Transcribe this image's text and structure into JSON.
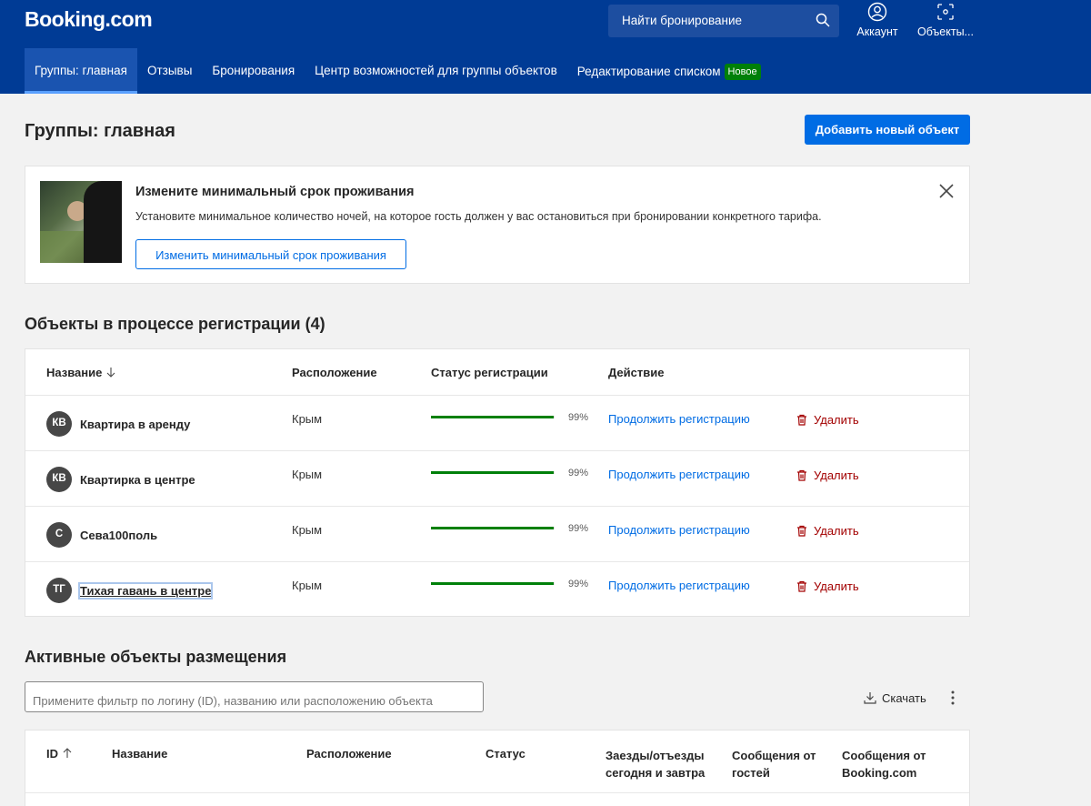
{
  "header": {
    "logo": "Booking.com",
    "search_label": "Найти бронирование",
    "account_label": "Аккаунт",
    "properties_label": "Объекты...",
    "nav": [
      {
        "label": "Группы: главная",
        "active": true
      },
      {
        "label": "Отзывы"
      },
      {
        "label": "Бронирования"
      },
      {
        "label": "Центр возможностей для группы объектов"
      },
      {
        "label": "Редактирование списком",
        "badge": "Новое"
      }
    ]
  },
  "page": {
    "title": "Группы: главная",
    "add_button": "Добавить новый объект"
  },
  "promo": {
    "title": "Измените минимальный срок проживания",
    "text": "Установите минимальное количество ночей, на которое гость должен у вас остановиться при бронировании конкретного тарифа.",
    "button": "Изменить минимальный срок проживания"
  },
  "registration": {
    "title": "Объекты в процессе регистрации (4)",
    "columns": {
      "name": "Название",
      "location": "Расположение",
      "status": "Статус регистрации",
      "action": "Действие"
    },
    "rows": [
      {
        "initials": "КВ",
        "name": "Квартира в аренду",
        "location": "Крым",
        "progress": 99,
        "progress_label": "99%",
        "action": "Продолжить регистрацию",
        "delete": "Удалить"
      },
      {
        "initials": "КВ",
        "name": "Квартирка в центре",
        "location": "Крым",
        "progress": 99,
        "progress_label": "99%",
        "action": "Продолжить регистрацию",
        "delete": "Удалить"
      },
      {
        "initials": "С",
        "name": "Сева100поль",
        "location": "Крым",
        "progress": 99,
        "progress_label": "99%",
        "action": "Продолжить регистрацию",
        "delete": "Удалить"
      },
      {
        "initials": "ТГ",
        "name": "Тихая гавань в центре",
        "location": "Крым",
        "progress": 99,
        "progress_label": "99%",
        "action": "Продолжить регистрацию",
        "delete": "Удалить"
      }
    ]
  },
  "active": {
    "title": "Активные объекты размещения",
    "filter_placeholder": "Примените фильтр по логину (ID), названию или расположению объекта",
    "download": "Скачать",
    "columns": {
      "id": "ID",
      "name": "Название",
      "location": "Расположение",
      "status": "Статус",
      "checkins_1": "Заезды/отъезды",
      "checkins_2": "сегодня и завтра",
      "guest_msgs_1": "Сообщения от",
      "guest_msgs_2": "гостей",
      "booking_msgs_1": "Сообщения от",
      "booking_msgs_2": "Booking.com"
    }
  },
  "colors": {
    "brand": "#003b95",
    "primary": "#006ce4",
    "success": "#008009",
    "danger": "#a30000"
  }
}
